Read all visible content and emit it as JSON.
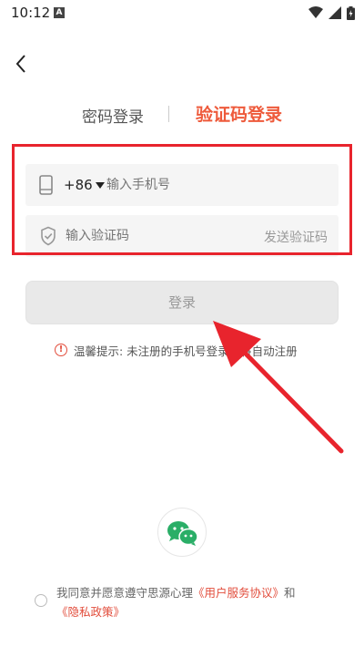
{
  "status_bar": {
    "time": "10:12",
    "notif_letter": "A"
  },
  "icons": {
    "back": "back-arrow-icon",
    "phone": "phone-icon",
    "shield": "shield-icon",
    "wechat": "wechat-icon",
    "alert": "alert-icon"
  },
  "tabs": {
    "password_login": "密码登录",
    "code_login": "验证码登录"
  },
  "phone_field": {
    "country_code": "+86",
    "placeholder": "输入手机号",
    "value": ""
  },
  "code_field": {
    "placeholder": "输入验证码",
    "value": "",
    "send_code": "发送验证码"
  },
  "login_button": {
    "label": "登录"
  },
  "tip": {
    "icon_glyph": "!",
    "text": "温馨提示: 未注册的手机号登录时将自动注册"
  },
  "agreement": {
    "prefix": "我同意并愿意遵守思源心理",
    "user_agreement": "《用户服务协议》",
    "and": "和",
    "privacy_policy": "《隐私政策》"
  },
  "colors": {
    "accent": "#ee5a3b",
    "annotation_red": "#e8242d",
    "wechat_green": "#2aae67"
  }
}
